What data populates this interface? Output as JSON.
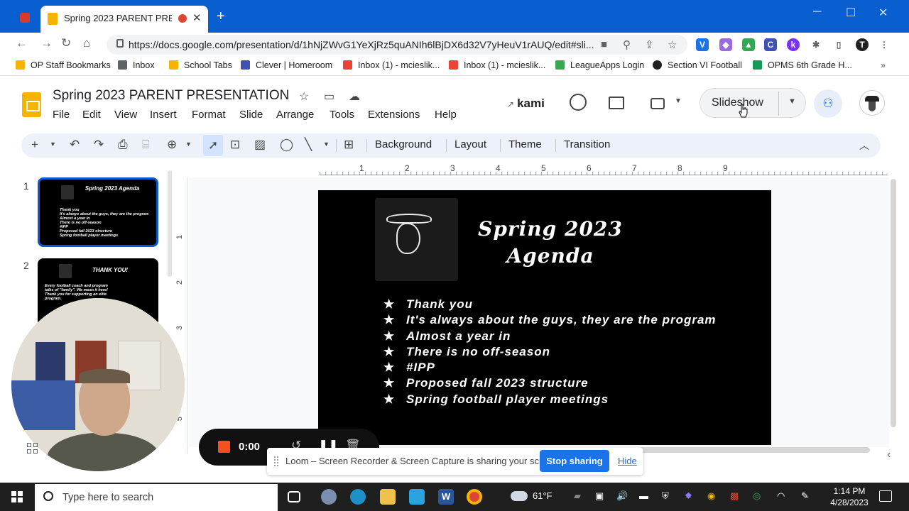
{
  "browser": {
    "tab_title": "Spring 2023 PARENT PRESEN",
    "new_tab_label": "+",
    "url": "https://docs.google.com/presentation/d/1hNjZWvG1YeXjRz5quANIh6lBjDX6d32V7yHeuV1rAUQ/edit#sli...",
    "bookmarks": [
      {
        "label": "OP Staff Bookmarks",
        "color": "#f4b400"
      },
      {
        "label": "Inbox",
        "color": "#5f6368"
      },
      {
        "label": "School Tabs",
        "color": "#f4b400"
      },
      {
        "label": "Clever | Homeroom",
        "color": "#3f51b5"
      },
      {
        "label": "Inbox (1) - mcieslik...",
        "color": "#ea4335"
      },
      {
        "label": "Inbox (1) - mcieslik...",
        "color": "#ea4335"
      },
      {
        "label": "LeagueApps Login",
        "color": "#34a853"
      },
      {
        "label": "Section VI Football",
        "color": "#202124"
      },
      {
        "label": "OPMS 6th Grade H...",
        "color": "#0f9d58"
      }
    ]
  },
  "docs": {
    "title": "Spring 2023 PARENT PRESENTATION",
    "menu": [
      "File",
      "Edit",
      "View",
      "Insert",
      "Format",
      "Slide",
      "Arrange",
      "Tools",
      "Extensions",
      "Help"
    ],
    "kami_label": "kami",
    "slideshow_label": "Slideshow",
    "toolbar_text": [
      "Background",
      "Layout",
      "Theme",
      "Transition"
    ]
  },
  "filmstrip": {
    "slides": [
      {
        "number": "1",
        "title": "Spring 2023 Agenda",
        "lines": [
          "Thank you",
          "It's always about the guys, they are the program",
          "Almost a year in",
          "There is no off-season",
          "#IPP",
          "Proposed fall 2023 structure",
          "Spring football player meetings"
        ]
      },
      {
        "number": "2",
        "title": "THANK YOU!",
        "lines": [
          "Every football coach and program",
          "talks of \"family\". We mean it here!",
          "Thank you for supporting an elite",
          "program."
        ]
      }
    ]
  },
  "ruler": {
    "top": [
      "1",
      "2",
      "3",
      "4",
      "5",
      "6",
      "7",
      "8",
      "9"
    ],
    "left": [
      "1",
      "2",
      "3",
      "4",
      "5"
    ]
  },
  "slide": {
    "title_line1": "Spring 2023",
    "title_line2": "Agenda",
    "bullets": [
      "Thank you",
      "It's always about the guys,  they are the program",
      "Almost a year in",
      "There is no off-season",
      "#IPP",
      "Proposed fall 2023 structure",
      "Spring football player meetings"
    ]
  },
  "loom": {
    "timer": "0:00",
    "banner_text": "Loom – Screen Recorder & Screen Capture is sharing your screen.",
    "stop_label": "Stop sharing",
    "hide_label": "Hide"
  },
  "taskbar": {
    "search_placeholder": "Type here to search",
    "weather": "61°F",
    "time": "1:14 PM",
    "date": "4/28/2023"
  },
  "colors": {
    "chrome_accent": "#0a5fd0",
    "slides_brand": "#f4b400",
    "selection": "#0b57d0",
    "loom_stop": "#f4511e",
    "stop_sharing": "#1a73e8"
  }
}
